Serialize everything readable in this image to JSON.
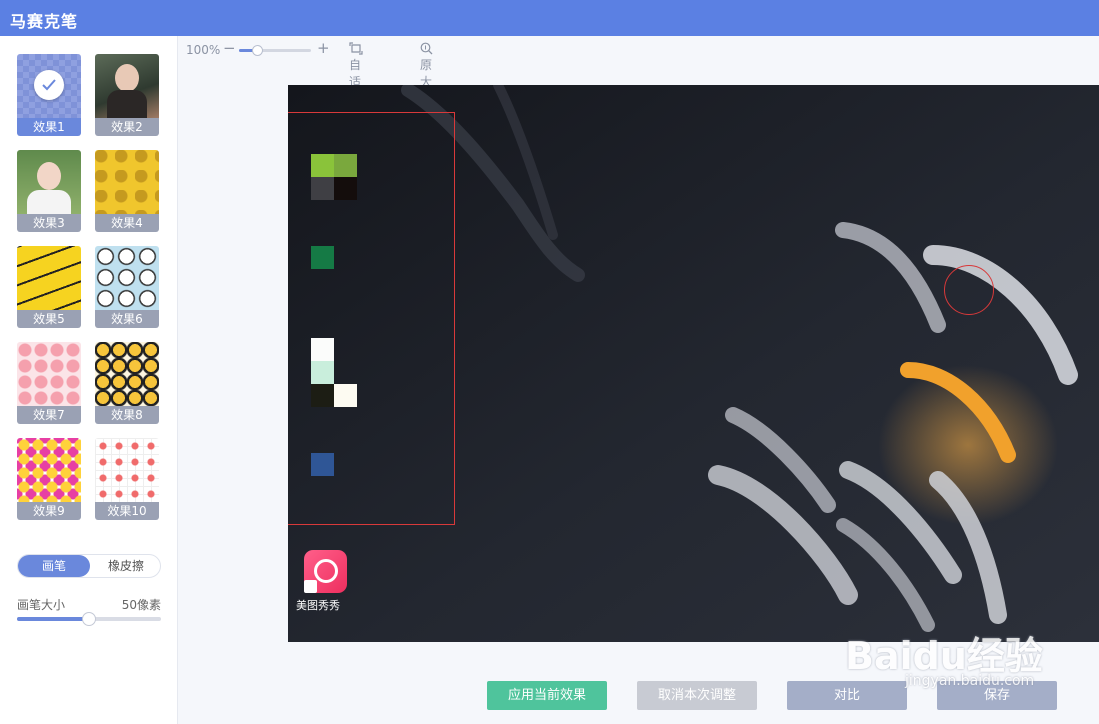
{
  "window": {
    "title": "马赛克笔"
  },
  "effects": {
    "items": [
      {
        "label": "效果1",
        "selected": true
      },
      {
        "label": "效果2"
      },
      {
        "label": "效果3"
      },
      {
        "label": "效果4"
      },
      {
        "label": "效果5"
      },
      {
        "label": "效果6"
      },
      {
        "label": "效果7"
      },
      {
        "label": "效果8"
      },
      {
        "label": "效果9"
      },
      {
        "label": "效果10"
      }
    ]
  },
  "tool_mode": {
    "brush_label": "画笔",
    "eraser_label": "橡皮擦",
    "active": "画笔"
  },
  "brush_size": {
    "label": "画笔大小",
    "value_text": "50像素",
    "fraction": 0.5
  },
  "toolbar": {
    "zoom_text": "100%",
    "zoom_minus": "−",
    "zoom_plus": "+",
    "zoom_fraction": 0.25,
    "fit_label": "自适应",
    "original_label": "原大小"
  },
  "canvas": {
    "app_label": "美图秀秀"
  },
  "actions": {
    "apply_label": "应用当前效果",
    "cancel_label": "取消本次调整",
    "compare_label": "对比",
    "save_label": "保存"
  },
  "watermark": {
    "brand": "Baidu经验",
    "url": "jingyan.baidu.com"
  },
  "colors": {
    "accent": "#5b80e3",
    "selected_label": "#6a88dc",
    "apply": "#4fc49c",
    "mark": "#d8393a"
  }
}
